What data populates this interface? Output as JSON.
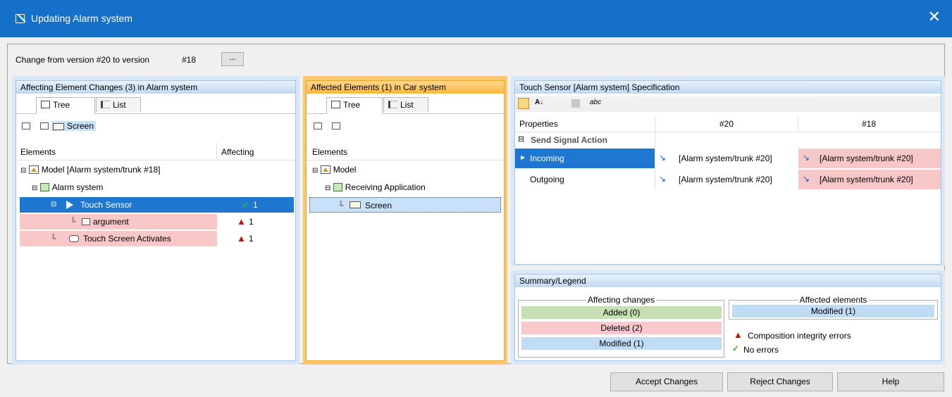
{
  "window": {
    "title": "Updating Alarm system",
    "close_label": "✕"
  },
  "version": {
    "label": "Change from version #20 to version",
    "value": "#18",
    "browse_label": "..."
  },
  "left_panel": {
    "title": "Affecting Element Changes (3) in Alarm system",
    "tabs": [
      {
        "label": "Tree"
      },
      {
        "label": "List"
      }
    ],
    "toolbar_filter": "Screen",
    "columns": {
      "elements": "Elements",
      "affecting": "Affecting"
    },
    "rows": [
      {
        "label": "Model [Alarm system/trunk #18]",
        "affecting": ""
      },
      {
        "label": "Alarm system",
        "affecting": ""
      },
      {
        "label": "Touch Sensor",
        "affecting": "1"
      },
      {
        "label": "argument",
        "affecting": "1"
      },
      {
        "label": "Touch Screen Activates",
        "affecting": "1"
      }
    ],
    "check_mark": "✓",
    "warn_mark": "▲"
  },
  "middle_panel": {
    "title": "Affected Elements (1) in Car system",
    "tabs": [
      {
        "label": "Tree"
      },
      {
        "label": "List"
      }
    ],
    "column": "Elements",
    "rows": [
      {
        "label": "Model"
      },
      {
        "label": "Receiving Application"
      },
      {
        "label": "Screen"
      }
    ]
  },
  "spec_panel": {
    "title": "Touch Sensor [Alarm system] Specification",
    "columns": {
      "properties": "Properties",
      "v1": "#20",
      "v2": "#18"
    },
    "section": "Send Signal Action",
    "rows": [
      {
        "name": "Incoming",
        "v1": "[Alarm system/trunk #20]",
        "v2": "[Alarm system/trunk #20]"
      },
      {
        "name": "Outgoing",
        "v1": "[Alarm system/trunk #20]",
        "v2": "[Alarm system/trunk #20]"
      }
    ],
    "toolbar_abc": "abc"
  },
  "legend": {
    "title": "Summary/Legend",
    "affecting_title": "Affecting changes",
    "added": "Added (0)",
    "deleted": "Deleted (2)",
    "modified": "Modified (1)",
    "affected_title": "Affected elements",
    "affected_modified": "Modified (1)",
    "integrity": "Composition integrity errors",
    "no_errors": "No errors",
    "colors": {
      "added": "#c6e0b4",
      "deleted": "#f8c8cc",
      "modified": "#c0dcf4"
    }
  },
  "buttons": {
    "accept": "Accept Changes",
    "reject": "Reject Changes",
    "help": "Help"
  }
}
